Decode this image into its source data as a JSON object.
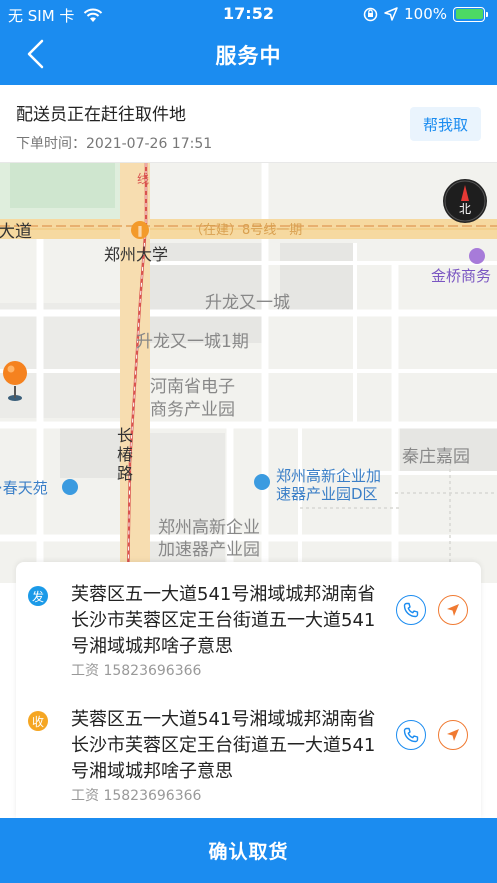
{
  "status_bar": {
    "carrier": "无 SIM 卡",
    "time": "17:52",
    "battery": "100%"
  },
  "nav": {
    "title": "服务中"
  },
  "order": {
    "status_text": "配送员正在赶往取件地",
    "order_time": "下单时间：2021-07-26 17:51",
    "help_button": "帮我取"
  },
  "map": {
    "labels": {
      "road_left": "大道",
      "metro": "（在建）8号线一期",
      "university": "郑州大学",
      "gold_bridge": "金桥商务",
      "shenglong": "升龙又一城",
      "shenglong_1": "升龙又一城1期",
      "henan_1": "河南省电子",
      "henan_2": "商务产业园",
      "changchun_1": "长",
      "changchun_2": "椿",
      "changchun_3": "路",
      "qinzhuang": "秦庄嘉园",
      "chuntian": "·春天苑",
      "zhengzhou_poi_1": "郑州高新企业加",
      "zhengzhou_poi_2": "速器产业园D区",
      "zhengzhou_area_1": "郑州高新企业",
      "zhengzhou_area_2": "加速器产业园",
      "line_top": "线",
      "compass_north": "北"
    }
  },
  "addresses": [
    {
      "badge": "发",
      "text": "芙蓉区五一大道541号湘域城邦湖南省长沙市芙蓉区定王台街道五一大道541号湘域城邦啥子意思",
      "contact": "工资 15823696366"
    },
    {
      "badge": "收",
      "text": "芙蓉区五一大道541号湘域城邦湖南省长沙市芙蓉区定王台街道五一大道541号湘域城邦啥子意思",
      "contact": "工资 15823696366"
    }
  ],
  "confirm_button": "确认取货",
  "colors": {
    "primary": "#1b8cf0",
    "send_badge": "#1b9ae8",
    "receive_badge": "#f5a623",
    "nav_icon": "#f07a32"
  }
}
